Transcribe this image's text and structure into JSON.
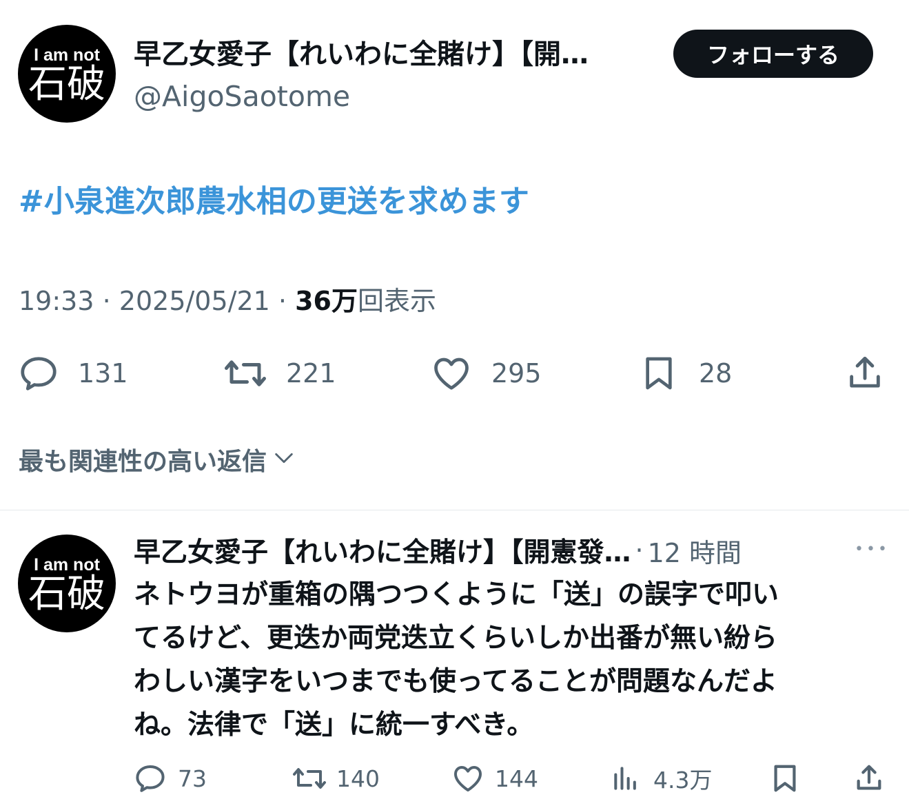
{
  "colors": {
    "link": "#3b94d9",
    "secondary": "#536471",
    "button_bg": "#0f1419"
  },
  "tweet": {
    "avatar": {
      "line1": "I am not",
      "line2": "石破"
    },
    "display_name": "早乙女愛子【れいわに全賭け】【開…",
    "handle": "@AigoSaotome",
    "follow_label": "フォローする",
    "text": "#小泉進次郎農水相の更送を求めます",
    "time": "19:33",
    "date": "2025/05/21",
    "views_number": "36万",
    "views_label": "回表示",
    "sep": "·",
    "counts": {
      "replies": "131",
      "retweets": "221",
      "likes": "295",
      "bookmarks": "28"
    },
    "icons": [
      "reply-icon",
      "retweet-icon",
      "like-icon",
      "bookmark-icon",
      "share-icon"
    ]
  },
  "sort": {
    "label": "最も関連性の高い返信"
  },
  "reply": {
    "avatar": {
      "line1": "I am not",
      "line2": "石破"
    },
    "display_name": "早乙女愛子【れいわに全賭け】【開憲發…",
    "sep": "·",
    "time": "12 時間",
    "more": "•••",
    "lines": [
      "ネトウヨが重箱の隅つつくように「送」の誤字で叩い",
      "てるけど、更迭か両党迭立くらいしか出番が無い紛ら",
      "わしい漢字をいつまでも使ってることが問題なんだよ",
      "ね。法律で「送」に統一すべき。"
    ],
    "counts": {
      "replies": "73",
      "retweets": "140",
      "likes": "144",
      "views": "4.3万"
    },
    "icons": [
      "reply-icon",
      "retweet-icon",
      "like-icon",
      "views-icon",
      "bookmark-icon",
      "share-icon"
    ]
  }
}
